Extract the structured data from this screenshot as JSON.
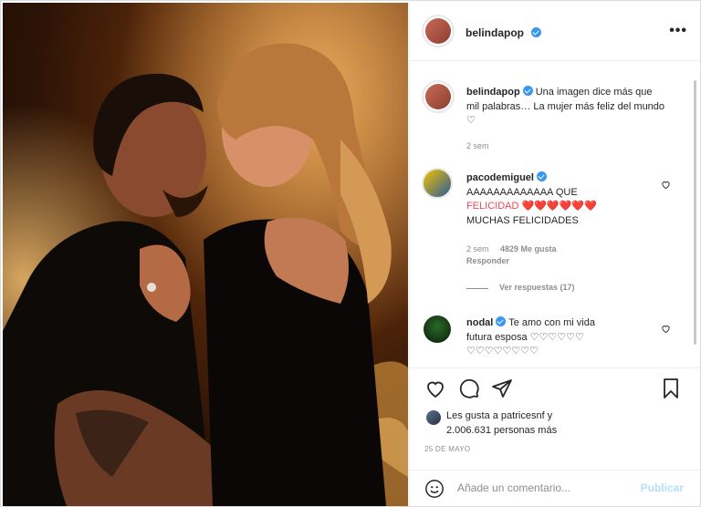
{
  "post": {
    "username": "belindapop",
    "more_icon": "more-horizontal-icon",
    "caption": "Una imagen dice más que mil palabras… La mujer más feliz del mundo ♡",
    "caption_time": "2 sem",
    "photo_alt": "couple-embracing-photo"
  },
  "comments": [
    {
      "username": "pacodemiguel",
      "text_line1": "AAAAAAAAAAAAA QUE",
      "text_line2": "FELICIDAD ❤️❤️❤️❤️❤️❤️",
      "text_line3": "MUCHAS FELICIDADES",
      "time": "2 sem",
      "likes": "4829 Me gusta",
      "reply": "Responder",
      "view_replies": "Ver respuestas (17)"
    },
    {
      "username": "nodal",
      "text_line1": "Te amo con mi vida",
      "text_line2": "futura esposa ♡♡♡♡♡♡",
      "text_line3": "♡♡♡♡♡♡♡♡"
    }
  ],
  "likes": {
    "line1": "Les gusta a patricesnf y",
    "line2": "2.006.631 personas más"
  },
  "date": "25 DE MAYO",
  "add_comment": {
    "placeholder": "Añade un comentario...",
    "publish": "Publicar"
  },
  "colors": {
    "verified": "#3897f0",
    "publish_disabled": "#b2dffc",
    "heart_red": "#ed4956"
  }
}
